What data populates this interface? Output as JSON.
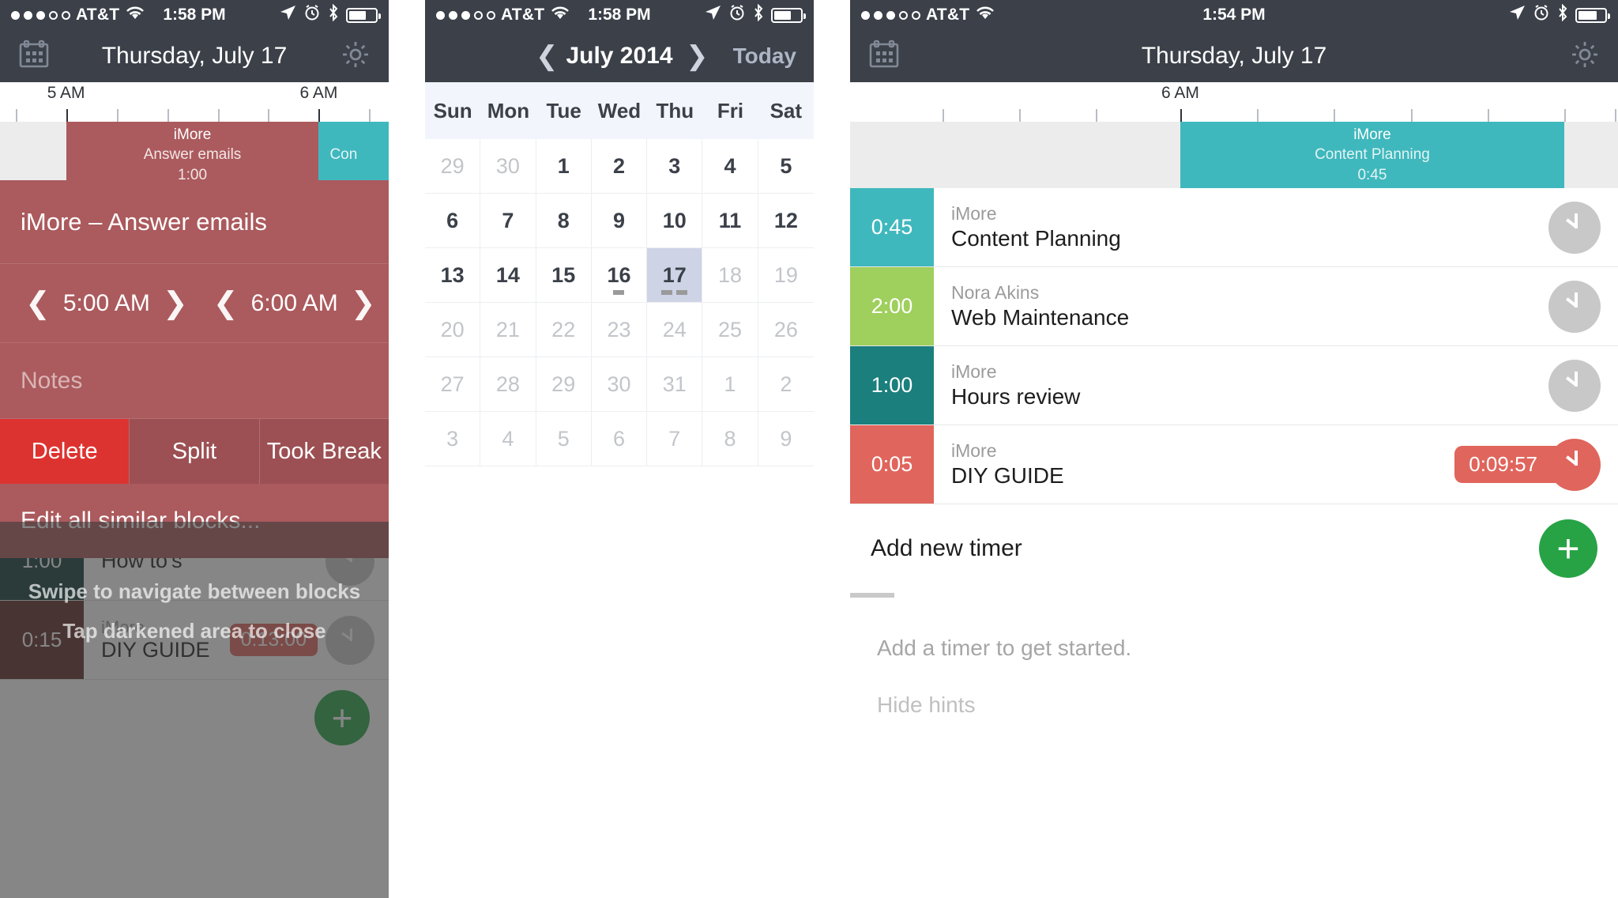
{
  "panel1": {
    "status": {
      "carrier": "AT&T",
      "time": "1:58 PM",
      "signal_filled": 3,
      "signal_empty": 2
    },
    "nav": {
      "calendar_icon": "calendar-icon",
      "title": "Thursday, July 17",
      "settings_icon": "gear-icon"
    },
    "timeline": {
      "labels": [
        {
          "text": "5 AM",
          "x_pct": 17
        },
        {
          "text": "6 AM",
          "x_pct": 82
        }
      ],
      "blocks": [
        {
          "client": "iMore",
          "task": "Answer emails",
          "duration": "1:00",
          "color": "#ab5a5d",
          "left_pct": 17,
          "width_pct": 65
        },
        {
          "client": "",
          "task": "Con",
          "duration": "",
          "color": "#3fb8bd",
          "left_pct": 82,
          "width_pct": 18
        }
      ]
    },
    "sheet": {
      "title": "iMore – Answer emails",
      "start_time": "5:00 AM",
      "end_time": "6:00 AM",
      "prev_icon": "chevron-left-icon",
      "next_icon": "chevron-right-icon",
      "notes_placeholder": "Notes",
      "actions": [
        {
          "label": "Delete",
          "style": "danger"
        },
        {
          "label": "Split",
          "style": "normal"
        },
        {
          "label": "Took Break",
          "style": "normal"
        }
      ],
      "edit_all": "Edit all similar blocks..."
    },
    "background_rows": [
      {
        "duration": "1:00",
        "client": "",
        "task": "How to's",
        "color": "#0f3b38",
        "running": ""
      },
      {
        "duration": "0:15",
        "client": "iMore",
        "task": "DIY GUIDE",
        "color": "#5c2a27",
        "running": "0:13:00"
      }
    ],
    "hints": [
      "Swipe to navigate between blocks",
      "Tap darkened area to close"
    ]
  },
  "panel2": {
    "status": {
      "carrier": "AT&T",
      "time": "1:58 PM",
      "signal_filled": 3,
      "signal_empty": 2
    },
    "nav": {
      "prev_icon": "chevron-left-icon",
      "title": "July 2014",
      "next_icon": "chevron-right-icon",
      "today_label": "Today"
    },
    "weekdays": [
      "Sun",
      "Mon",
      "Tue",
      "Wed",
      "Thu",
      "Fri",
      "Sat"
    ],
    "weeks": [
      [
        {
          "d": "29",
          "muted": true
        },
        {
          "d": "30",
          "muted": true
        },
        {
          "d": "1",
          "muted": false
        },
        {
          "d": "2",
          "muted": false
        },
        {
          "d": "3",
          "muted": false
        },
        {
          "d": "4",
          "muted": false
        },
        {
          "d": "5",
          "muted": false
        }
      ],
      [
        {
          "d": "6",
          "muted": false
        },
        {
          "d": "7",
          "muted": false
        },
        {
          "d": "8",
          "muted": false
        },
        {
          "d": "9",
          "muted": false
        },
        {
          "d": "10",
          "muted": false
        },
        {
          "d": "11",
          "muted": false
        },
        {
          "d": "12",
          "muted": false
        }
      ],
      [
        {
          "d": "13",
          "muted": false
        },
        {
          "d": "14",
          "muted": false
        },
        {
          "d": "15",
          "muted": false
        },
        {
          "d": "16",
          "muted": false,
          "marks": 1
        },
        {
          "d": "17",
          "muted": false,
          "today": true,
          "marks": 2
        },
        {
          "d": "18",
          "muted": true
        },
        {
          "d": "19",
          "muted": true
        }
      ],
      [
        {
          "d": "20",
          "muted": true
        },
        {
          "d": "21",
          "muted": true
        },
        {
          "d": "22",
          "muted": true
        },
        {
          "d": "23",
          "muted": true
        },
        {
          "d": "24",
          "muted": true
        },
        {
          "d": "25",
          "muted": true
        },
        {
          "d": "26",
          "muted": true
        }
      ],
      [
        {
          "d": "27",
          "muted": true
        },
        {
          "d": "28",
          "muted": true
        },
        {
          "d": "29",
          "muted": true
        },
        {
          "d": "30",
          "muted": true
        },
        {
          "d": "31",
          "muted": true
        },
        {
          "d": "1",
          "muted": true
        },
        {
          "d": "2",
          "muted": true
        }
      ],
      [
        {
          "d": "3",
          "muted": true
        },
        {
          "d": "4",
          "muted": true
        },
        {
          "d": "5",
          "muted": true
        },
        {
          "d": "6",
          "muted": true
        },
        {
          "d": "7",
          "muted": true
        },
        {
          "d": "8",
          "muted": true
        },
        {
          "d": "9",
          "muted": true
        }
      ]
    ]
  },
  "panel3": {
    "status": {
      "carrier": "AT&T",
      "time": "1:54 PM",
      "signal_filled": 3,
      "signal_empty": 2
    },
    "nav": {
      "calendar_icon": "calendar-icon",
      "title": "Thursday, July 17",
      "settings_icon": "gear-icon"
    },
    "timeline": {
      "labels": [
        {
          "text": "6 AM",
          "x_pct": 42
        }
      ],
      "blocks": [
        {
          "client": "iMore",
          "task": "Content Planning",
          "duration": "0:45",
          "color": "#3fb8bd",
          "left_pct": 43,
          "width_pct": 50
        }
      ]
    },
    "timers": [
      {
        "duration": "0:45",
        "client": "iMore",
        "task": "Content Planning",
        "color": "#3fb8bd",
        "running": "",
        "icon": "clock-icon"
      },
      {
        "duration": "2:00",
        "client": "Nora Akins",
        "task": "Web Maintenance",
        "color": "#9fcf5d",
        "running": "",
        "icon": "clock-icon"
      },
      {
        "duration": "1:00",
        "client": "iMore",
        "task": "Hours review",
        "color": "#1b7f7d",
        "running": "",
        "icon": "clock-icon"
      },
      {
        "duration": "0:05",
        "client": "iMore",
        "task": "DIY GUIDE",
        "color": "#e0655c",
        "running": "0:09:57",
        "icon": "clock-icon"
      }
    ],
    "add_timer": {
      "label": "Add new timer",
      "icon": "plus-icon"
    },
    "hints": [
      "Add a timer to get started.",
      "Hide hints"
    ]
  },
  "colors": {
    "navbar": "#3b4049",
    "sheet": "#ab5a5d",
    "danger": "#dd3330",
    "teal": "#3fb8bd",
    "green": "#9fcf5d",
    "dark_teal": "#1b7f7d",
    "salmon": "#e0655c",
    "add_green": "#27a345",
    "today_highlight": "#ced3e6"
  }
}
